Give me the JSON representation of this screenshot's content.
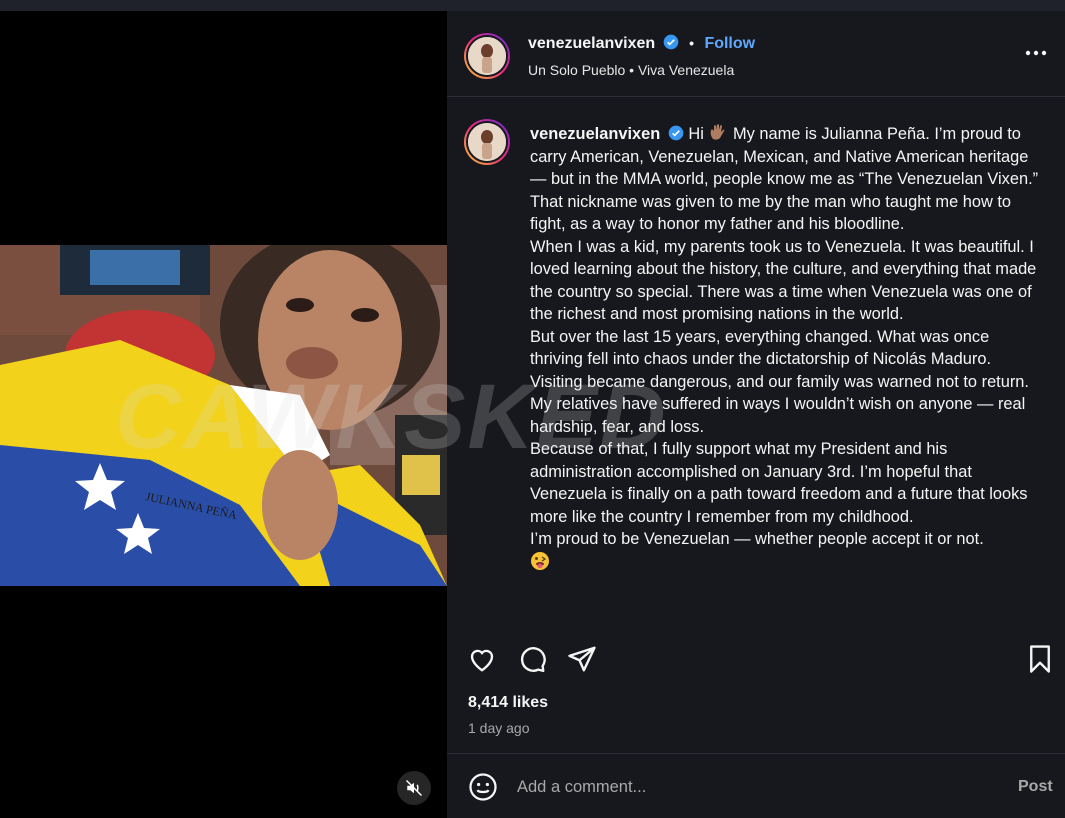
{
  "post": {
    "username": "venezuelanvixen",
    "follow_label": "Follow",
    "location": "Un Solo Pueblo • Viva Venezuela",
    "likes": "8,414 likes",
    "time_ago": "1 day ago"
  },
  "caption": {
    "username": "venezuelanvixen",
    "greeting": "Hi",
    "line1": "My name is Julianna Peña. I’m proud to carry American, Venezuelan, Mexican, and Native American heritage — but in the MMA world, people know me as “The Venezuelan Vixen.” That nickname was given to me by the man who taught me how to fight, as a way to honor my father and his bloodline.",
    "para2": "When I was a kid, my parents took us to Venezuela. It was beautiful. I loved learning about the history, the culture, and everything that made the country so special. There was a time when Venezuela was one of the richest and most promising nations in the world.",
    "para3": "But over the last 15 years, everything changed. What was once thriving fell into chaos under the dictatorship of Nicolás Maduro. Visiting became dangerous, and our family was warned not to return. My relatives have suffered in ways I wouldn’t wish on anyone — real hardship, fear, and loss.",
    "para4": "Because of that, I fully support what my President and his administration accomplished on January 3rd. I’m hopeful that Venezuela is finally on a path toward freedom and a future that looks more like the country I remember from my childhood.",
    "para5": "I’m proud to be Venezuelan — whether people accept it or not."
  },
  "photo": {
    "jacket_text": "JULIANNA PEÑA"
  },
  "comment": {
    "placeholder": "Add a comment...",
    "post_label": "Post"
  },
  "watermark": "CAWKSKED",
  "icons": {
    "verified": "verified-badge-icon",
    "more": "more-options-icon",
    "like": "heart-icon",
    "comment": "comment-icon",
    "share": "share-icon",
    "save": "bookmark-icon",
    "emoji": "smiley-icon",
    "mute": "speaker-muted-icon"
  },
  "colors": {
    "accent": "#5fa8ff",
    "panel_bg": "#16181d"
  }
}
